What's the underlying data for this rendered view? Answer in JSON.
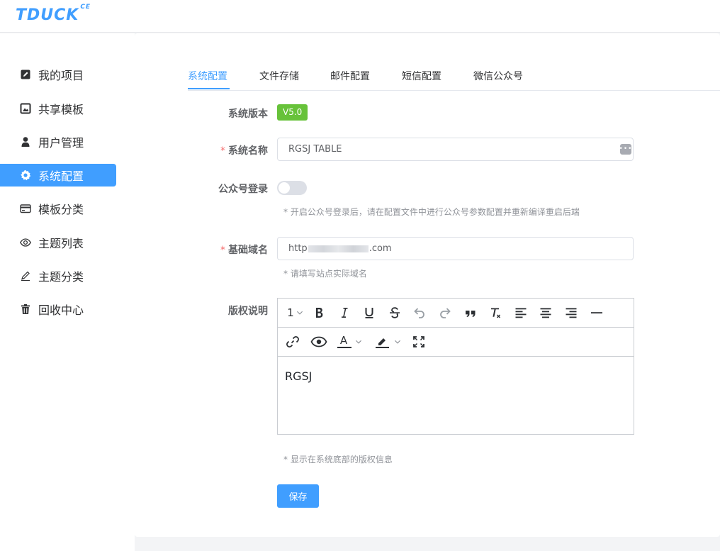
{
  "app": {
    "logo": "TDUCK",
    "logo_sup": "CE"
  },
  "sidebar": {
    "items": [
      {
        "label": "我的项目",
        "icon": "edit-square-icon",
        "active": false
      },
      {
        "label": "共享模板",
        "icon": "picture-icon",
        "active": false
      },
      {
        "label": "用户管理",
        "icon": "user-icon",
        "active": false
      },
      {
        "label": "系统配置",
        "icon": "gear-icon",
        "active": true
      },
      {
        "label": "模板分类",
        "icon": "credit-card-icon",
        "active": false
      },
      {
        "label": "主题列表",
        "icon": "eye-icon",
        "active": false
      },
      {
        "label": "主题分类",
        "icon": "pen-icon",
        "active": false
      },
      {
        "label": "回收中心",
        "icon": "trash-icon",
        "active": false
      }
    ]
  },
  "tabs": [
    {
      "label": "系统配置",
      "active": true
    },
    {
      "label": "文件存储",
      "active": false
    },
    {
      "label": "邮件配置",
      "active": false
    },
    {
      "label": "短信配置",
      "active": false
    },
    {
      "label": "微信公众号",
      "active": false
    }
  ],
  "form": {
    "version_label": "系统版本",
    "version_value": "V5.0",
    "name_label": "系统名称",
    "name_value": "RGSJ TABLE",
    "wx_login_label": "公众号登录",
    "wx_login_enabled": false,
    "wx_login_hint": "* 开启公众号登录后，请在配置文件中进行公众号参数配置并重新编译重启后端",
    "domain_label": "基础域名",
    "domain_prefix": "http",
    "domain_suffix": ".com",
    "domain_hint": "* 请填写站点实际域名",
    "copyright_label": "版权说明",
    "copyright_content": "RGSJ",
    "copyright_hint": "* 显示在系统底部的版权信息",
    "required_mark": "*"
  },
  "editor_toolbar": {
    "heading_label": "1",
    "font_color_letter": "A"
  },
  "actions": {
    "save_label": "保存"
  },
  "colors": {
    "primary": "#409eff",
    "success": "#67c23a",
    "danger": "#f56c6c"
  }
}
